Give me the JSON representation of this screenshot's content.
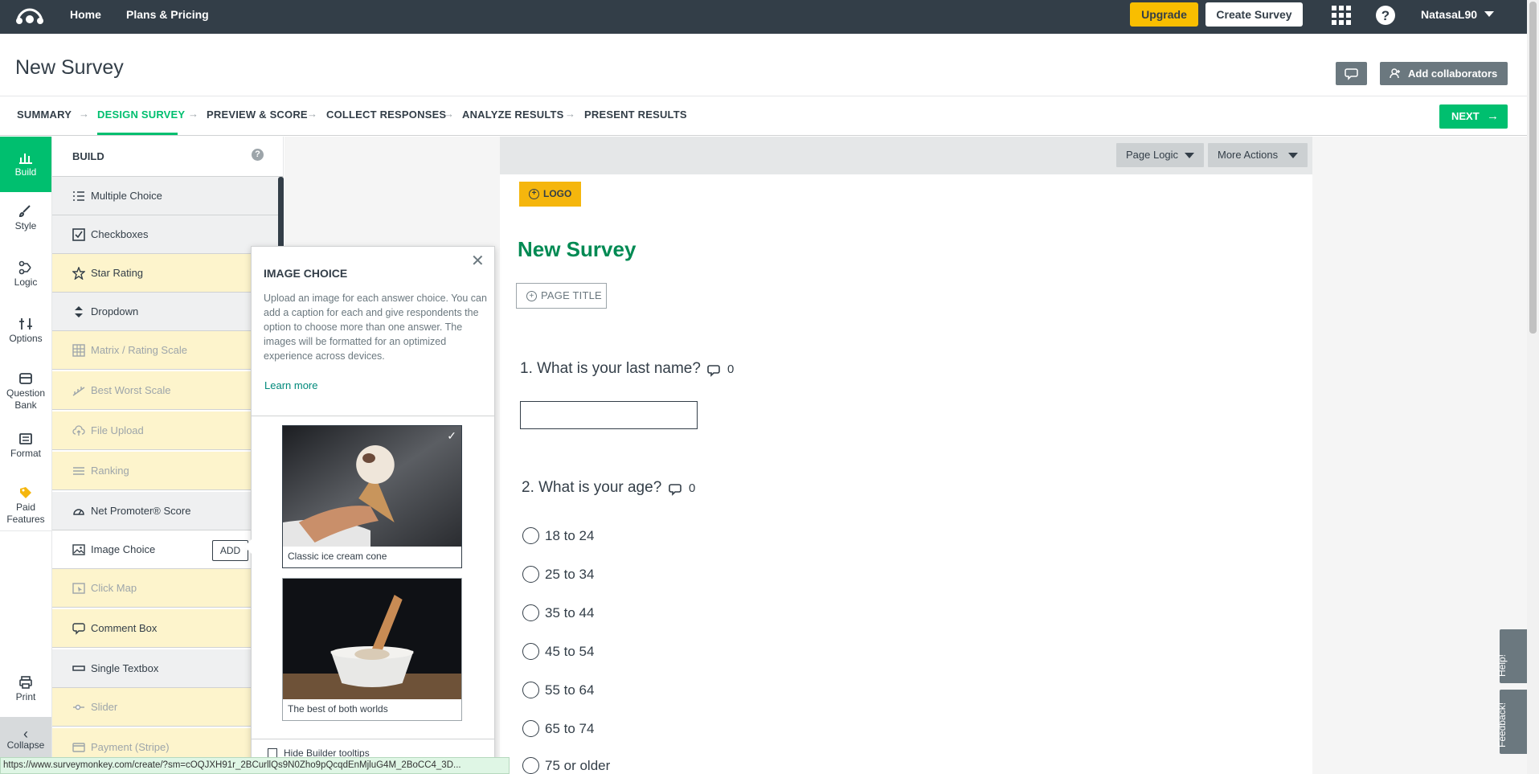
{
  "topbar": {
    "nav": [
      "Home",
      "Plans & Pricing"
    ],
    "upgrade_label": "Upgrade",
    "create_label": "Create Survey",
    "username": "NatasaL90"
  },
  "header": {
    "title": "New Survey",
    "collab_label": "Add collaborators"
  },
  "steps": [
    "SUMMARY",
    "DESIGN SURVEY",
    "PREVIEW & SCORE",
    "COLLECT RESPONSES",
    "ANALYZE RESULTS",
    "PRESENT RESULTS"
  ],
  "active_step": "DESIGN SURVEY",
  "next_label": "NEXT",
  "rail": {
    "items": [
      "Build",
      "Style",
      "Logic",
      "Options",
      "Question Bank",
      "Format",
      "Paid Features"
    ],
    "print_label": "Print",
    "collapse_label": "Collapse"
  },
  "build": {
    "title": "BUILD",
    "help": "?",
    "add_label": "ADD",
    "types": [
      "Multiple Choice",
      "Checkboxes",
      "Star Rating",
      "Dropdown",
      "Matrix / Rating Scale",
      "Best Worst Scale",
      "File Upload",
      "Ranking",
      "Net Promoter® Score",
      "Image Choice",
      "Click Map",
      "Comment Box",
      "Single Textbox",
      "Slider",
      "Payment (Stripe)"
    ]
  },
  "toolbar": {
    "page_logic": "Page Logic",
    "more_actions": "More Actions"
  },
  "page": {
    "logo_label": "LOGO",
    "heading": "New Survey",
    "page_title_label": "PAGE TITLE",
    "q1": {
      "text": "1. What is your last name?",
      "comments": "0"
    },
    "q2": {
      "text": "2. What is your age?",
      "comments": "0"
    },
    "choices": [
      "18 to 24",
      "25 to 34",
      "35 to 44",
      "45 to 54",
      "55 to 64",
      "65 to 74",
      "75 or older"
    ]
  },
  "popover": {
    "title": "IMAGE CHOICE",
    "description": "Upload an image for each answer choice. You can add a caption for each and give respondents the option to choose more than one answer. The images will be formatted for an optimized experience across devices.",
    "learn_more": "Learn more",
    "images": [
      {
        "caption": "Classic ice cream cone"
      },
      {
        "caption": "The best of both worlds"
      }
    ],
    "hide_tooltips": "Hide Builder tooltips"
  },
  "side_tabs": {
    "help": "Help!",
    "feedback": "Feedback!"
  },
  "status_url": "https://www.surveymonkey.com/create/?sm=cOQJXH91r_2BCurllQs9N0Zho9pQcqdEnMjluG4M_2BoCC4_3D..."
}
